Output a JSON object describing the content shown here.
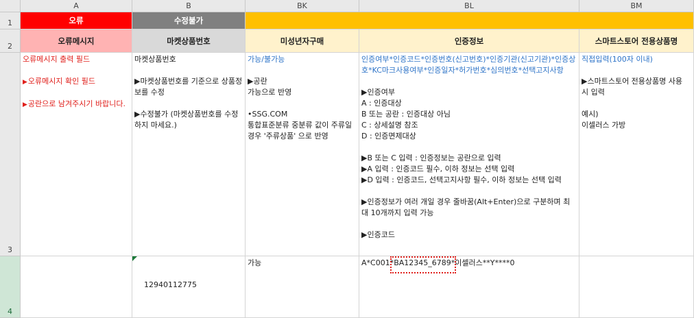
{
  "columns": {
    "A": "A",
    "B": "B",
    "BK": "BK",
    "BL": "BL",
    "BM": "BM"
  },
  "rows": {
    "r1": "1",
    "r2": "2",
    "r3": "3",
    "r4": "4"
  },
  "row1": {
    "a": "오류",
    "b": "수정불가"
  },
  "row2": {
    "a": "오류메시지",
    "b": "마켓상품번호",
    "bk": "미성년자구매",
    "bl": "인증정보",
    "bm": "스마트스토어 전용상품명"
  },
  "row3": {
    "a": {
      "l1": "오류메시지 출력 필드",
      "l2": "오류메시지 확인 필드",
      "l3": "공란으로 남겨주시기 바랍니다."
    },
    "b": {
      "l1": "마켓상품번호",
      "l2": "마켓상품번호를 기준으로 상품정보를 수정",
      "l3": "수정불가 (마켓상품번호를 수정하지 마세요.)"
    },
    "bk": {
      "l1": "가능/불가능",
      "l2": "공란\n가능으로 반영",
      "l3": "•SSG.COM\n통합표준분류 중분류 값이 주류일 경우 '주류상품' 으로 반영"
    },
    "bl": {
      "l1": "인증여부*인증코드*인증번호(신고번호)*인증기관(신고기관)*인증상호*KC마크사용여부*인증일자*허가번호*심의번호*선택고지사항",
      "l2": "인증여부\nA : 인증대상\nB 또는 공란 : 인증대상 아님\nC : 상세설명 참조\nD : 인증면제대상",
      "l3": "B 또는 C 입력 : 인증정보는 공란으로 입력",
      "l4": "A 입력 : 인증코드 필수, 이하 정보는 선택 입력",
      "l5": "D 입력 : 인증코드, 선택고지사항 필수, 이하 정보는 선택 입력",
      "l6": "인증정보가 여러 개일 경우 줄바꿈(Alt+Enter)으로 구분하며 최대 10개까지 입력 가능",
      "l7": "인증코드"
    },
    "bm": {
      "l1": "직접입력(100자 이내)",
      "l2": "스마트스토어 전용상품명 사용 시 입력",
      "l3": "예시)\n이셀러스 가방"
    }
  },
  "row4": {
    "b": "12940112775",
    "bk": "가능",
    "bl_pre": "A*C001*",
    "bl_sel": "BA12345_6789",
    "bl_post": "*이셀러스**Y****0"
  },
  "colors": {
    "error_red": "#ff0000",
    "gray": "#808080",
    "yellow": "#ffc000",
    "pink": "#ffb3b3",
    "lightgray": "#d9d9d9",
    "cream": "#fff2cc"
  }
}
